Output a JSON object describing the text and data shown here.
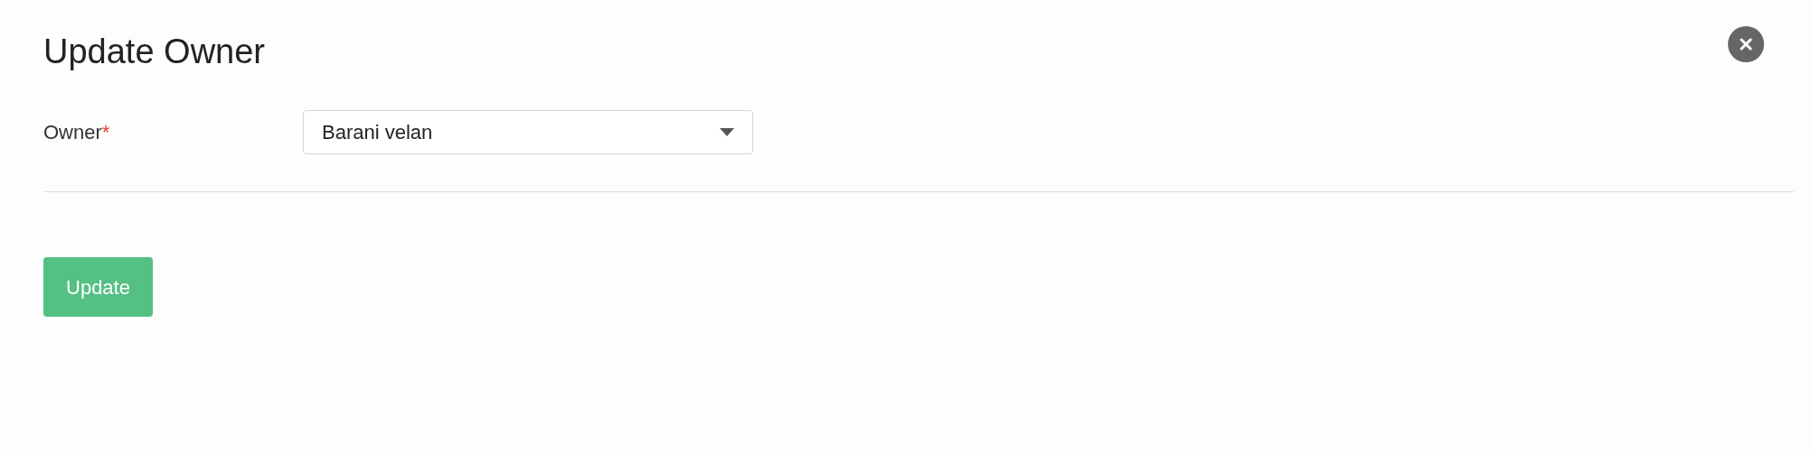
{
  "dialog": {
    "title": "Update Owner"
  },
  "fields": [
    {
      "label": "Owner",
      "required_mark": "*",
      "value": "Barani velan"
    }
  ],
  "buttons": [
    {
      "label": "Update"
    }
  ]
}
